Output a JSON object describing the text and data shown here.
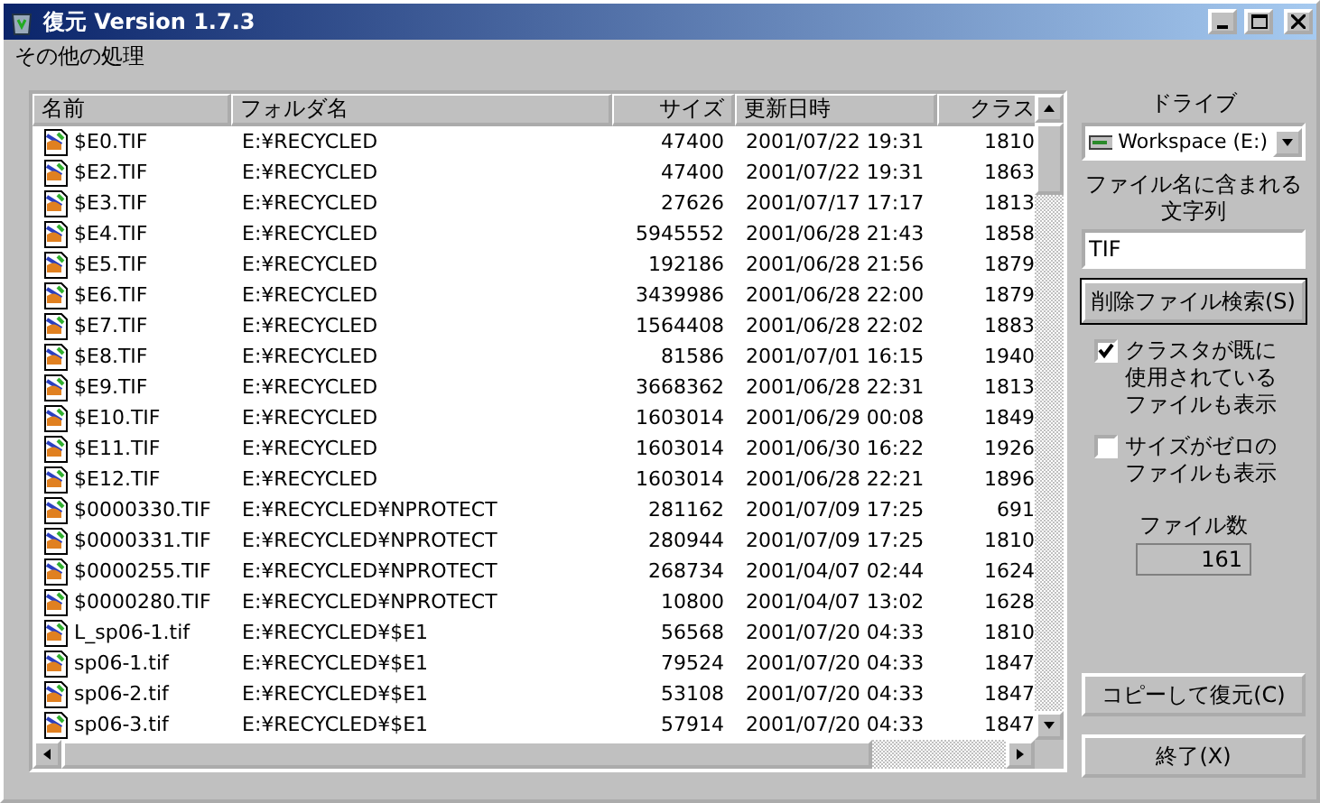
{
  "window": {
    "title": "復元 Version 1.7.3"
  },
  "menu": [
    "その他の処理"
  ],
  "table": {
    "columns": [
      "名前",
      "フォルダ名",
      "サイズ",
      "更新日時",
      "クラス"
    ],
    "rows": [
      [
        "$E0.TIF",
        "E:¥RECYCLED",
        "47400",
        "2001/07/22 19:31",
        "1810"
      ],
      [
        "$E2.TIF",
        "E:¥RECYCLED",
        "47400",
        "2001/07/22 19:31",
        "1863"
      ],
      [
        "$E3.TIF",
        "E:¥RECYCLED",
        "27626",
        "2001/07/17 17:17",
        "1813"
      ],
      [
        "$E4.TIF",
        "E:¥RECYCLED",
        "5945552",
        "2001/06/28 21:43",
        "1858"
      ],
      [
        "$E5.TIF",
        "E:¥RECYCLED",
        "192186",
        "2001/06/28 21:56",
        "1879"
      ],
      [
        "$E6.TIF",
        "E:¥RECYCLED",
        "3439986",
        "2001/06/28 22:00",
        "1879"
      ],
      [
        "$E7.TIF",
        "E:¥RECYCLED",
        "1564408",
        "2001/06/28 22:02",
        "1883"
      ],
      [
        "$E8.TIF",
        "E:¥RECYCLED",
        "81586",
        "2001/07/01 16:15",
        "1940"
      ],
      [
        "$E9.TIF",
        "E:¥RECYCLED",
        "3668362",
        "2001/06/28 22:31",
        "1813"
      ],
      [
        "$E10.TIF",
        "E:¥RECYCLED",
        "1603014",
        "2001/06/29 00:08",
        "1849"
      ],
      [
        "$E11.TIF",
        "E:¥RECYCLED",
        "1603014",
        "2001/06/30 16:22",
        "1926"
      ],
      [
        "$E12.TIF",
        "E:¥RECYCLED",
        "1603014",
        "2001/06/28 22:21",
        "1896"
      ],
      [
        "$0000330.TIF",
        "E:¥RECYCLED¥NPROTECT",
        "281162",
        "2001/07/09 17:25",
        "691"
      ],
      [
        "$0000331.TIF",
        "E:¥RECYCLED¥NPROTECT",
        "280944",
        "2001/07/09 17:25",
        "1810"
      ],
      [
        "$0000255.TIF",
        "E:¥RECYCLED¥NPROTECT",
        "268734",
        "2001/04/07 02:44",
        "1624"
      ],
      [
        "$0000280.TIF",
        "E:¥RECYCLED¥NPROTECT",
        "10800",
        "2001/04/07 13:02",
        "1628"
      ],
      [
        "L_sp06-1.tif",
        "E:¥RECYCLED¥$E1",
        "56568",
        "2001/07/20 04:33",
        "1810"
      ],
      [
        "sp06-1.tif",
        "E:¥RECYCLED¥$E1",
        "79524",
        "2001/07/20 04:33",
        "1847"
      ],
      [
        "sp06-2.tif",
        "E:¥RECYCLED¥$E1",
        "53108",
        "2001/07/20 04:33",
        "1847"
      ],
      [
        "sp06-3.tif",
        "E:¥RECYCLED¥$E1",
        "57914",
        "2001/07/20 04:33",
        "1847"
      ]
    ]
  },
  "panel": {
    "drive_label": "ドライブ",
    "drive": "Workspace (E:)",
    "filter_label": "ファイル名に含まれる文字列",
    "filter_value": "TIF",
    "search_button": "削除ファイル検索(S)",
    "options": [
      {
        "label": "クラスタが既に使用されているファイルも表示",
        "checked": true
      },
      {
        "label": "サイズがゼロのファイルも表示",
        "checked": false
      }
    ],
    "count_label": "ファイル数",
    "count": "161",
    "buttons": [
      "コピーして復元(C)",
      "終了(X)"
    ]
  }
}
